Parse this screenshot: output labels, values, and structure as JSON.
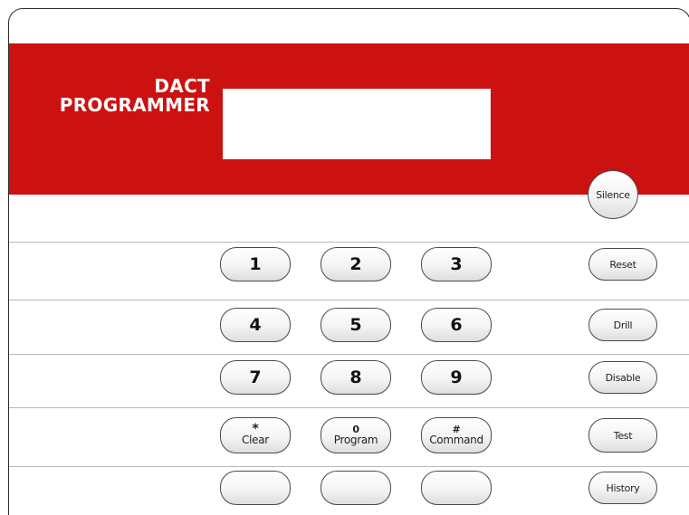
{
  "brand": {
    "line1": "DACT",
    "line2": "PROGRAMMER"
  },
  "display": {
    "text": ""
  },
  "keys": {
    "k1": "1",
    "k2": "2",
    "k3": "3",
    "k4": "4",
    "k5": "5",
    "k6": "6",
    "k7": "7",
    "k8": "8",
    "k9": "9",
    "clear": {
      "symbol": "*",
      "label": "Clear"
    },
    "program": {
      "symbol": "0",
      "label": "Program"
    },
    "command": {
      "symbol": "#",
      "label": "Command"
    },
    "blank1": "",
    "blank2": "",
    "blank3": ""
  },
  "side_buttons": {
    "silence": "Silence",
    "reset": "Reset",
    "drill": "Drill",
    "disable": "Disable",
    "test": "Test",
    "history": "History"
  },
  "colors": {
    "band": "#cc1111",
    "brand_text": "#ffffff",
    "background": "#ffffff"
  }
}
